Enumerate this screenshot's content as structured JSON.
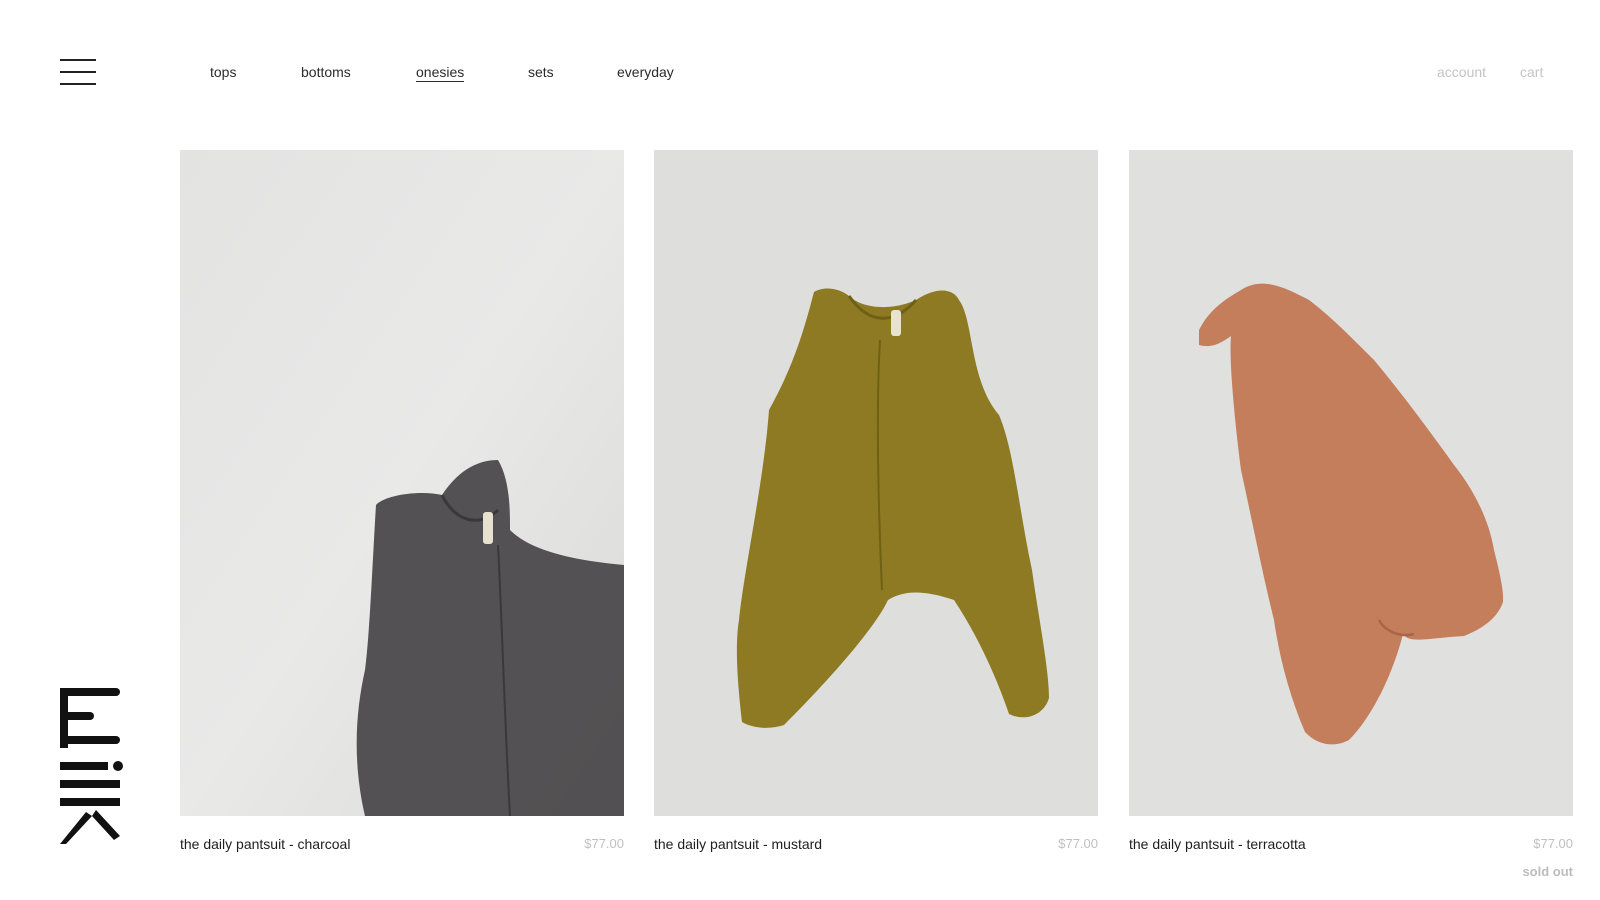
{
  "brand": {
    "logo_text": "milk"
  },
  "nav": {
    "items": [
      {
        "label": "tops"
      },
      {
        "label": "bottoms"
      },
      {
        "label": "onesies",
        "active": true
      },
      {
        "label": "sets"
      },
      {
        "label": "everyday"
      }
    ]
  },
  "utility": {
    "account_label": "account",
    "cart_label": "cart"
  },
  "products": [
    {
      "name": "the daily pantsuit - charcoal",
      "price": "$77.00",
      "color": "#4b494b"
    },
    {
      "name": "the daily pantsuit - mustard",
      "price": "$77.00",
      "color": "#8d7a23"
    },
    {
      "name": "the daily pantsuit - terracotta",
      "price": "$77.00",
      "color": "#c47e5c",
      "badge": "sold out"
    }
  ],
  "icons": {
    "menu": "hamburger-menu-icon",
    "logo": "milk-logo"
  }
}
